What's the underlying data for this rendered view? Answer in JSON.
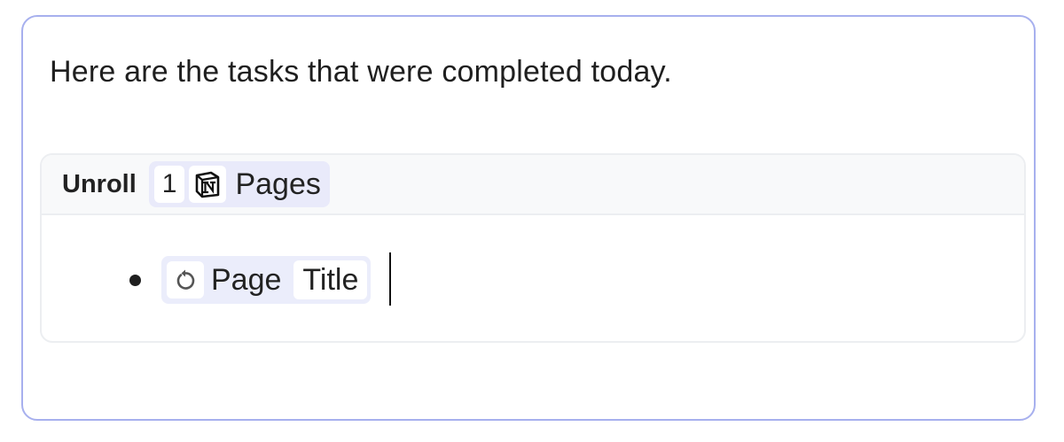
{
  "message": {
    "text": "Here are the tasks that were completed today."
  },
  "unroll_block": {
    "label": "Unroll",
    "source_chip": {
      "count": "1",
      "icon": "notion-logo-icon",
      "text": "Pages"
    },
    "items": [
      {
        "icon": "refresh-icon",
        "words": [
          "Page",
          "Title"
        ]
      }
    ]
  },
  "colors": {
    "editor_border": "#a7b0ee",
    "chip_background": "#e9eafa",
    "header_background": "#f8f9fa"
  }
}
